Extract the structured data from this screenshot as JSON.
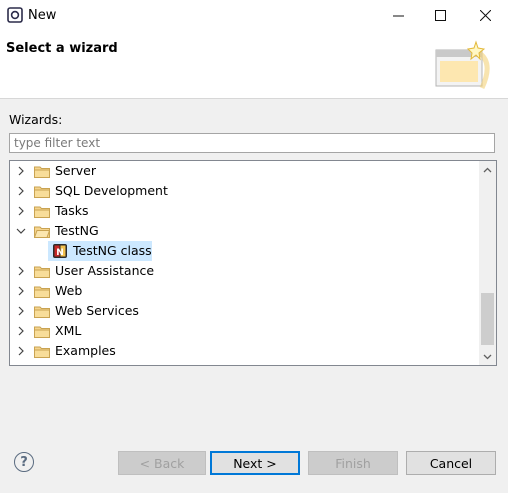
{
  "window": {
    "title": "New"
  },
  "header": {
    "title": "Select a wizard"
  },
  "wizards_label": "Wizards:",
  "filter": {
    "placeholder": "type filter text",
    "value": ""
  },
  "tree": {
    "items": [
      {
        "label": "Server",
        "expanded": false,
        "type": "folder"
      },
      {
        "label": "SQL Development",
        "expanded": false,
        "type": "folder"
      },
      {
        "label": "Tasks",
        "expanded": false,
        "type": "folder"
      },
      {
        "label": "TestNG",
        "expanded": true,
        "type": "folder"
      },
      {
        "label": "TestNG class",
        "type": "wizard",
        "selected": true
      },
      {
        "label": "User Assistance",
        "expanded": false,
        "type": "folder"
      },
      {
        "label": "Web",
        "expanded": false,
        "type": "folder"
      },
      {
        "label": "Web Services",
        "expanded": false,
        "type": "folder"
      },
      {
        "label": "XML",
        "expanded": false,
        "type": "folder"
      },
      {
        "label": "Examples",
        "expanded": false,
        "type": "folder"
      }
    ]
  },
  "buttons": {
    "help": "?",
    "back": "< Back",
    "next": "Next >",
    "finish": "Finish",
    "cancel": "Cancel"
  },
  "colors": {
    "selection": "#cce8ff",
    "folder": "#dcb67a",
    "accent": "#0078d7"
  }
}
